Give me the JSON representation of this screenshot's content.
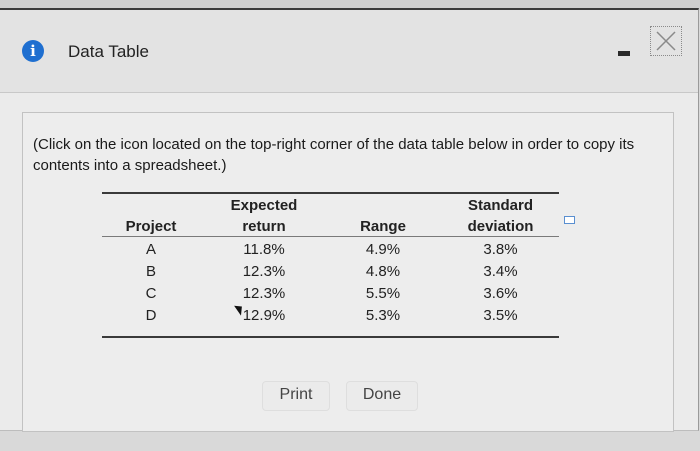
{
  "window": {
    "title": "Data Table"
  },
  "instruction": "(Click on the icon located on the top-right corner of the data table below in order to copy its contents into a spreadsheet.)",
  "table": {
    "headers": {
      "project": "Project",
      "expected_line1": "Expected",
      "expected_line2": "return",
      "range": "Range",
      "std_line1": "Standard",
      "std_line2": "deviation"
    },
    "rows": [
      {
        "project": "A",
        "expected_return": "11.8%",
        "range": "4.9%",
        "std_dev": "3.8%"
      },
      {
        "project": "B",
        "expected_return": "12.3%",
        "range": "4.8%",
        "std_dev": "3.4%"
      },
      {
        "project": "C",
        "expected_return": "12.3%",
        "range": "5.5%",
        "std_dev": "3.6%"
      },
      {
        "project": "D",
        "expected_return": "12.9%",
        "range": "5.3%",
        "std_dev": "3.5%"
      }
    ]
  },
  "buttons": {
    "print": "Print",
    "done": "Done"
  },
  "icons": {
    "info": "info-icon",
    "minimize": "minimize-icon",
    "close": "close-icon",
    "copy": "copy-icon"
  },
  "colors": {
    "info_icon": "#1f6fd0",
    "copy_icon": "#5a8fd0"
  }
}
